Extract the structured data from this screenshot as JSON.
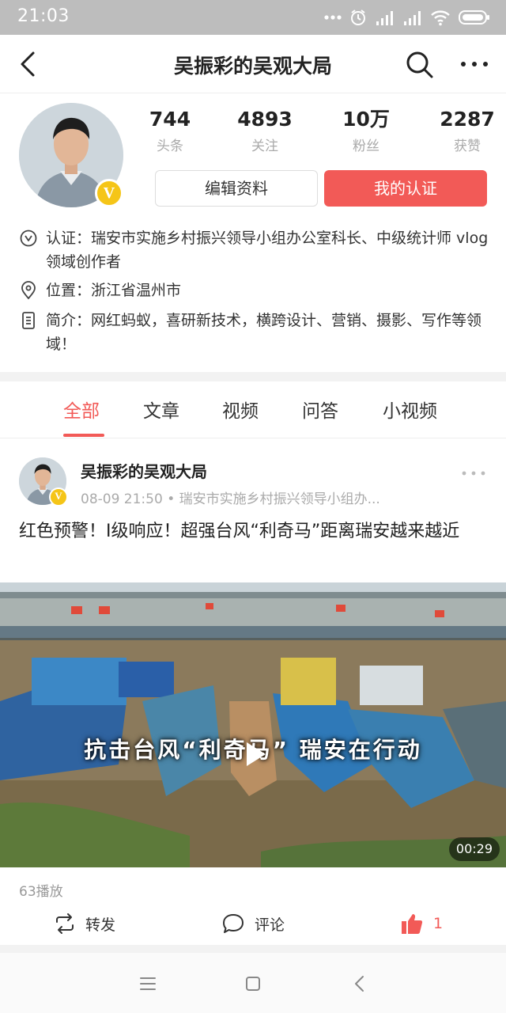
{
  "status_bar": {
    "time": "21:03",
    "icons": [
      "more-dots-icon",
      "alarm-icon",
      "hd-signal-icon",
      "signal-icon",
      "wifi-icon",
      "battery-icon"
    ]
  },
  "header": {
    "title": "吴振彩的吴观大局",
    "icons": [
      "back-icon",
      "search-icon",
      "more-icon"
    ]
  },
  "profile": {
    "badge": "V",
    "stats": [
      {
        "value": "744",
        "label": "头条"
      },
      {
        "value": "4893",
        "label": "关注"
      },
      {
        "value": "10万",
        "label": "粉丝"
      },
      {
        "value": "2287",
        "label": "获赞"
      }
    ],
    "edit_button": "编辑资料",
    "verify_button": "我的认证",
    "verification": "认证：瑞安市实施乡村振兴领导小组办公室科长、中级统计师 vlog领域创作者",
    "location": "位置：浙江省温州市",
    "intro": "简介：网红蚂蚁，喜研新技术，横跨设计、营销、摄影、写作等领域！"
  },
  "tabs": [
    {
      "label": "全部",
      "active": true
    },
    {
      "label": "文章",
      "active": false
    },
    {
      "label": "视频",
      "active": false
    },
    {
      "label": "问答",
      "active": false
    },
    {
      "label": "小视频",
      "active": false
    }
  ],
  "post": {
    "author": "吴振彩的吴观大局",
    "badge": "V",
    "meta": "08-09 21:50 • 瑞安市实施乡村振兴领导小组办...",
    "title": "红色预警！I级响应！超强台风“利奇马”距离瑞安越来越近",
    "video": {
      "overlay_text": "抗击台风“利奇马”  瑞安在行动",
      "duration": "00:29"
    },
    "plays": "63播放",
    "actions": {
      "repost": "转发",
      "comment": "评论",
      "like_count": "1"
    }
  },
  "colors": {
    "accent": "#f25a57",
    "badge": "#f5c518",
    "status_bar": "#bdbdbd"
  },
  "system_nav": [
    "menu-icon",
    "home-square-icon",
    "back-triangle-icon"
  ]
}
